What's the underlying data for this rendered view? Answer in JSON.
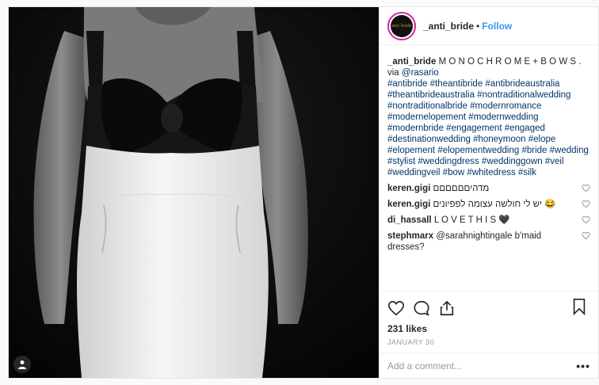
{
  "header": {
    "avatar_text": "anti bride",
    "username": "_anti_bride",
    "separator": "•",
    "follow_label": "Follow"
  },
  "caption": {
    "username": "_anti_bride",
    "text": "M O N O C H R O M E + B O W S .",
    "via_prefix": "via ",
    "via_handle": "@rasario",
    "hashtags": [
      "#antibride",
      "#theantibride",
      "#antibrideaustralia",
      "#theantibrideaustralia",
      "#nontraditionalwedding",
      "#nontraditionalbride",
      "#modernromance",
      "#modernelopement",
      "#modernwedding",
      "#modernbride",
      "#engagement",
      "#engaged",
      "#destinationwedding",
      "#honeymoon",
      "#elope",
      "#elopement",
      "#elopementwedding",
      "#bride",
      "#wedding",
      "#stylist",
      "#weddingdress",
      "#weddinggown",
      "#veil",
      "#weddingveil",
      "#bow",
      "#whitedress",
      "#silk"
    ]
  },
  "comments": [
    {
      "username": "keren.gigi",
      "text": "מדהיםםםםםם"
    },
    {
      "username": "keren.gigi",
      "text": "יש לי חולשה עצומה לפפיונים 😂"
    },
    {
      "username": "di_hassall",
      "text": "L O V E T H I S 🖤"
    },
    {
      "username": "stephmarx",
      "mention": "@sarahnightingale",
      "text": " b'maid dresses?"
    }
  ],
  "icons": {
    "like": "heart-outline-icon",
    "comment": "comment-bubble-icon",
    "share": "share-icon",
    "save": "bookmark-icon",
    "comment_like": "small-heart-icon",
    "user_tag": "person-icon",
    "more": "ellipsis-icon"
  },
  "stats": {
    "likes": "231 likes",
    "date": "JANUARY 30"
  },
  "add_comment": {
    "placeholder": "Add a comment...",
    "more_label": "•••"
  },
  "colors": {
    "link": "#003569",
    "follow": "#3897f0",
    "avatar_ring": "#d6249f"
  }
}
